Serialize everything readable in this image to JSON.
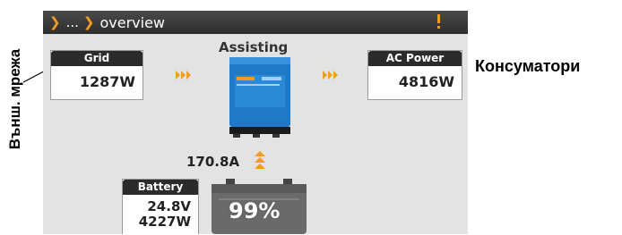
{
  "annotations": {
    "left_label": "Външ. мрежа",
    "right_label": "Консуматори"
  },
  "header": {
    "breadcrumb": [
      "...",
      "overview"
    ],
    "icons": [
      "chevron-right-icon",
      "alert-icon"
    ],
    "accent_color": "#f39c1f"
  },
  "overview": {
    "mode": "Assisting",
    "grid": {
      "label": "Grid",
      "value": "1287W"
    },
    "ac_power": {
      "label": "AC Power",
      "value": "4816W"
    },
    "inverter_icon": "inverter-icon",
    "current": "170.8A",
    "battery": {
      "label": "Battery",
      "voltage": "24.8V",
      "power": "4227W",
      "soc": "99%"
    }
  }
}
